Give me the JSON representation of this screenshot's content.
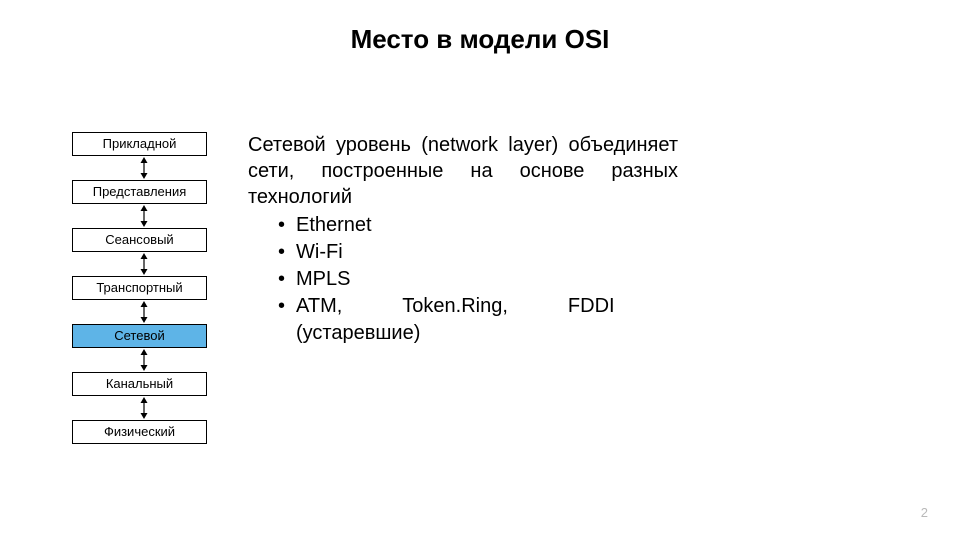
{
  "title": "Место в модели OSI",
  "layers": [
    {
      "label": "Прикладной",
      "highlight": false
    },
    {
      "label": "Представления",
      "highlight": false
    },
    {
      "label": "Сеансовый",
      "highlight": false
    },
    {
      "label": "Транспортный",
      "highlight": false
    },
    {
      "label": "Сетевой",
      "highlight": true
    },
    {
      "label": "Канальный",
      "highlight": false
    },
    {
      "label": "Физический",
      "highlight": false
    }
  ],
  "paragraph": "Сетевой уровень (network layer) объединяет сети, построенные на основе разных технологий",
  "bullets": [
    "Ethernet",
    "Wi-Fi",
    "MPLS",
    "ATM,   Token.Ring,   FDDI (устаревшие)"
  ],
  "page_number": "2"
}
